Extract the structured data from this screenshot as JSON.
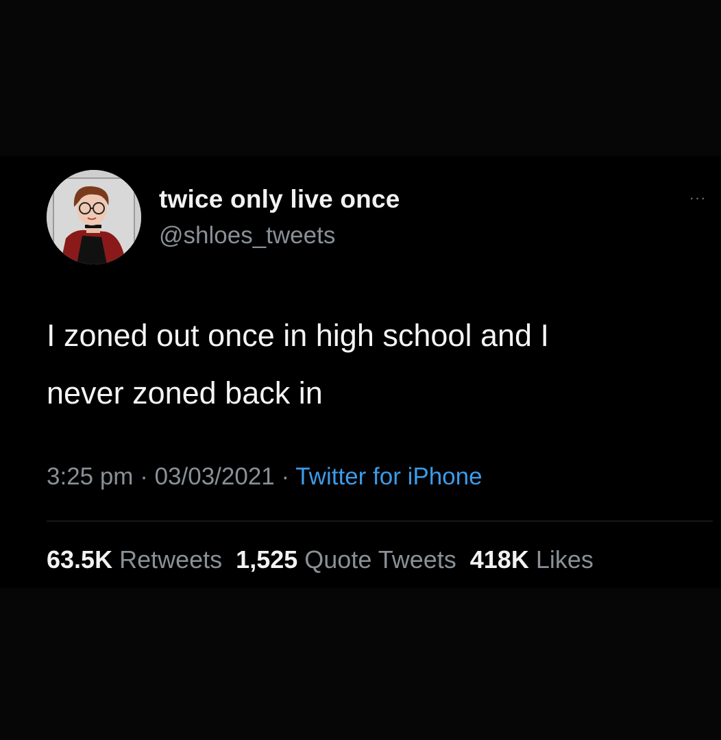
{
  "tweet": {
    "display_name": "twice only live once",
    "handle": "@shloes_tweets",
    "more_icon": "more-dots-icon",
    "more_label": "···",
    "text_line1": "I zoned out once in high school and I",
    "text_line2": "never zoned back in",
    "time": "3:25 pm",
    "date": "03/03/2021",
    "separator": " · ",
    "source": "Twitter for iPhone",
    "stats": {
      "retweets_count": "63.5K",
      "retweets_label": "Retweets",
      "quotes_count": "1,525",
      "quotes_label": "Quote Tweets",
      "likes_count": "418K",
      "likes_label": "Likes"
    }
  },
  "colors": {
    "background": "#000000",
    "text_primary": "#f2f2f2",
    "text_secondary": "#8a9097",
    "link": "#3d9be9"
  }
}
